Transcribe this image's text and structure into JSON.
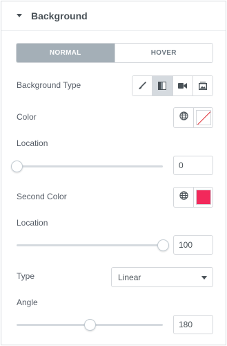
{
  "section": {
    "title": "Background"
  },
  "tabs": [
    {
      "label": "NORMAL"
    },
    {
      "label": "HOVER"
    }
  ],
  "background_type": {
    "label": "Background Type",
    "options": [
      "classic-brush-icon",
      "gradient-icon",
      "video-icon",
      "slideshow-icon"
    ],
    "selected": "gradient"
  },
  "color": {
    "label": "Color",
    "value": "",
    "state": "empty"
  },
  "location": {
    "label": "Location",
    "value": "0",
    "fraction": 0
  },
  "second_color": {
    "label": "Second Color",
    "value": "#f2295b"
  },
  "second_location": {
    "label": "Location",
    "value": "100",
    "fraction": 1
  },
  "type": {
    "label": "Type",
    "value": "Linear"
  },
  "angle": {
    "label": "Angle",
    "value": "180",
    "fraction": 0.5
  },
  "colors": {
    "accent_tab": "#a4afb7",
    "border": "#d5d8dc",
    "text": "#555c66"
  }
}
